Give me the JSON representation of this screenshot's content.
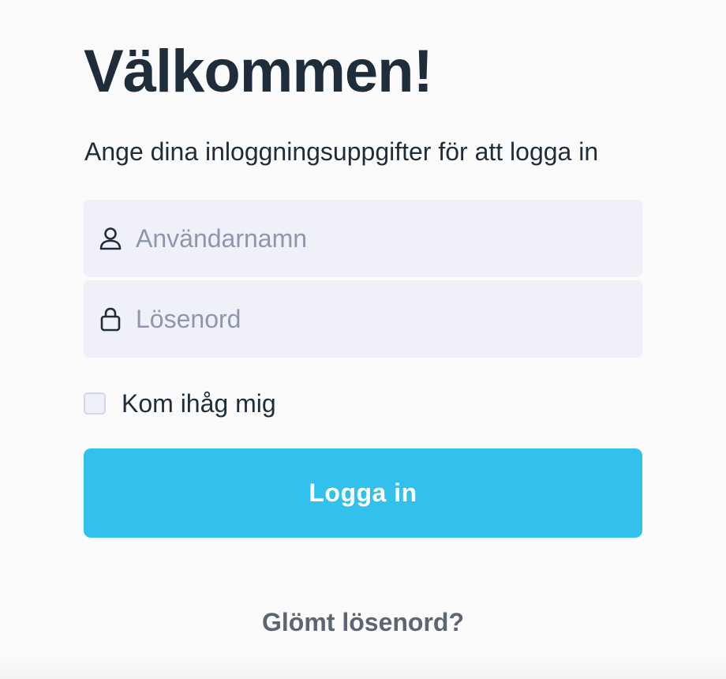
{
  "login": {
    "title": "Välkommen!",
    "subtitle": "Ange dina inloggningsuppgifter för att logga in",
    "username": {
      "placeholder": "Användarnamn",
      "value": "",
      "icon": "user-icon"
    },
    "password": {
      "placeholder": "Lösenord",
      "value": "",
      "icon": "lock-icon"
    },
    "remember": {
      "label": "Kom ihåg mig",
      "checked": false
    },
    "submit_label": "Logga in",
    "forgot_label": "Glömt lösenord?"
  },
  "colors": {
    "accent": "#31c1ec",
    "field_bg": "#f0f1f8",
    "text": "#1f2d3a",
    "placeholder": "#8d97ac",
    "muted": "#5d6572"
  }
}
